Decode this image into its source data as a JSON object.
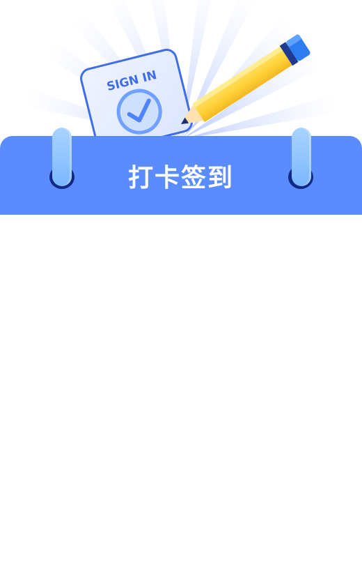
{
  "header": {
    "title": "打卡签到",
    "illustration": {
      "card_label": "SIGN IN",
      "icons": [
        "sign-in-card-icon",
        "checkmark-icon",
        "pencil-icon"
      ]
    },
    "banner_color": "#5b8cff",
    "ring_color": "#8ec3ff",
    "ring_hole_color": "#102a86"
  }
}
